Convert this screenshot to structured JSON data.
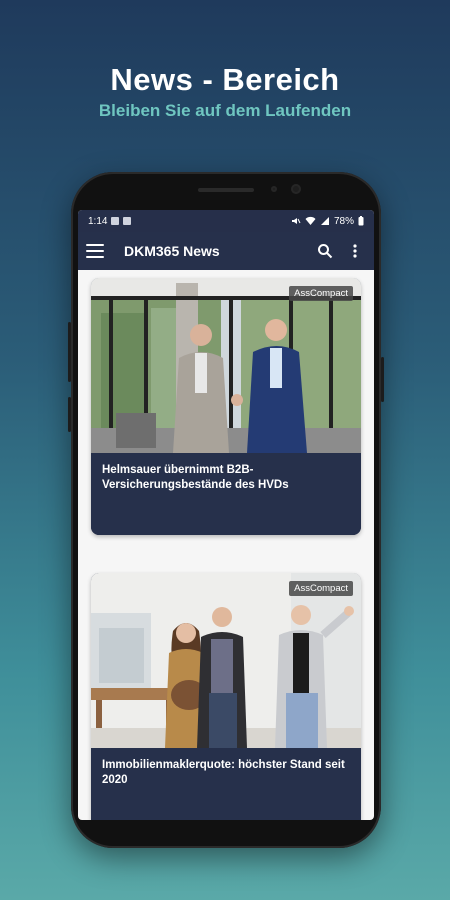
{
  "promo": {
    "title": "News - Bereich",
    "subtitle": "Bleiben Sie auf dem Laufenden"
  },
  "status_bar": {
    "time": "1:14",
    "battery": "78%"
  },
  "app_bar": {
    "title": "DKM365 News",
    "icons": [
      "menu-icon",
      "search-icon",
      "more-vert-icon"
    ]
  },
  "articles": [
    {
      "source": "AssCompact",
      "title": "Helmsauer übernimmt B2B-Versicherungsbestände des HVDs"
    },
    {
      "source": "AssCompact",
      "title": "Immobilienmaklerquote: höchster Stand seit 2020"
    }
  ],
  "colors": {
    "app_bar": "#26304b",
    "subtitle_accent": "#6fc6c0"
  }
}
